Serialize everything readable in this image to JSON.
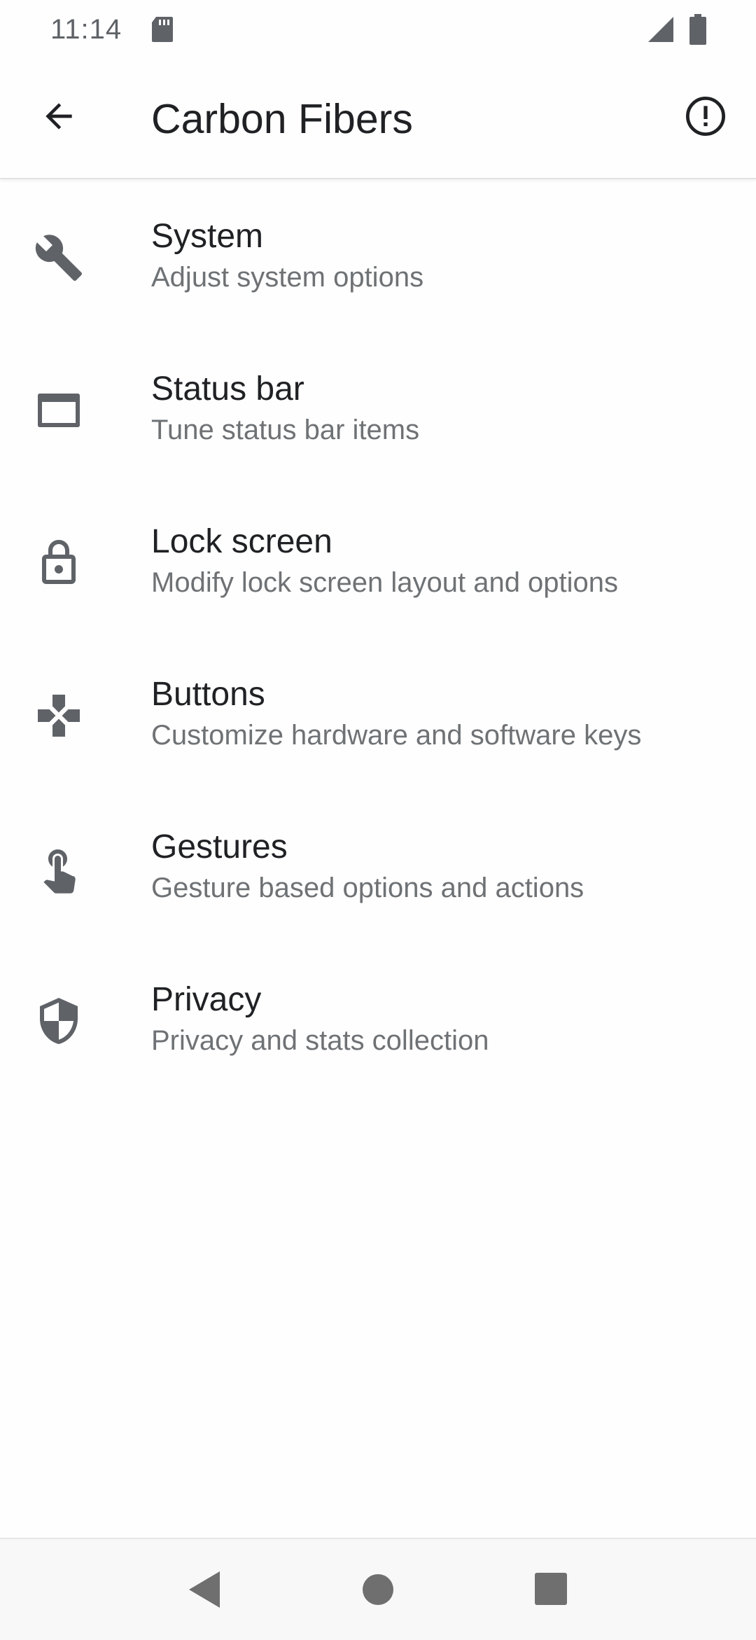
{
  "status_bar": {
    "time": "11:14",
    "icons": [
      "sd-card-icon",
      "cell-signal-icon",
      "battery-icon"
    ]
  },
  "app_bar": {
    "title": "Carbon Fibers",
    "back_icon": "arrow-back-icon",
    "action_icon": "info-icon"
  },
  "menu": {
    "items": [
      {
        "title": "System",
        "subtitle": "Adjust system options",
        "icon": "wrench-icon"
      },
      {
        "title": "Status bar",
        "subtitle": "Tune status bar items",
        "icon": "status-bar-window-icon"
      },
      {
        "title": "Lock screen",
        "subtitle": "Modify lock screen layout and options",
        "icon": "lock-icon"
      },
      {
        "title": "Buttons",
        "subtitle": "Customize hardware and software keys",
        "icon": "gamepad-icon"
      },
      {
        "title": "Gestures",
        "subtitle": "Gesture based options and actions",
        "icon": "touch-gesture-icon"
      },
      {
        "title": "Privacy",
        "subtitle": "Privacy and stats collection",
        "icon": "shield-icon"
      }
    ]
  },
  "nav_bar": {
    "icons": [
      "nav-back-icon",
      "nav-home-icon",
      "nav-recents-icon"
    ]
  },
  "colors": {
    "background": "#fefefe",
    "title_text": "#202124",
    "subtitle_text": "#6f7275",
    "icon": "#5f6368",
    "nav_bar": "#f8f8f8"
  }
}
